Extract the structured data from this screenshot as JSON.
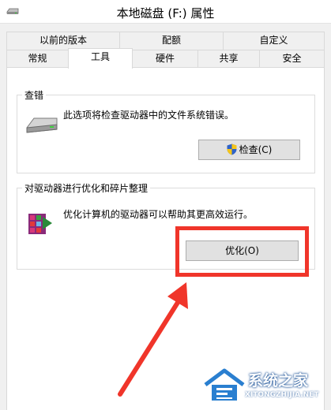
{
  "window": {
    "title": "本地磁盘 (F:) 属性"
  },
  "tabs_back": [
    {
      "label": "以前的版本"
    },
    {
      "label": "配额"
    },
    {
      "label": "自定义"
    }
  ],
  "tabs_front": [
    {
      "label": "常规"
    },
    {
      "label": "工具",
      "active": true
    },
    {
      "label": "硬件"
    },
    {
      "label": "共享"
    },
    {
      "label": "安全"
    }
  ],
  "error_check": {
    "title": "查错",
    "description": "此选项将检查驱动器中的文件系统错误。",
    "button_label": "检查(C)",
    "icon": "drive-icon"
  },
  "optimize": {
    "title": "对驱动器进行优化和碎片整理",
    "description": "优化计算机的驱动器可以帮助其更高效运行。",
    "button_label": "优化(O)",
    "icon": "defrag-icon"
  },
  "annotation": {
    "color": "#f0352a",
    "shape": "red-rectangle-and-arrow"
  },
  "watermark": {
    "text": "系统之家",
    "url": "XITONGZHIJIA.NET"
  }
}
